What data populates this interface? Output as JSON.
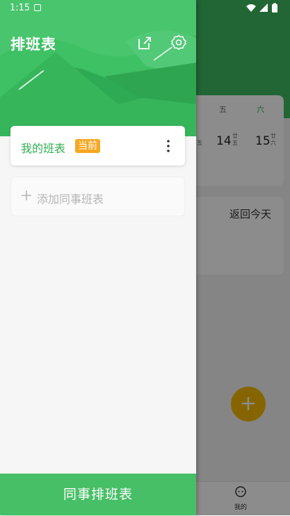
{
  "status_bar": {
    "time": "1:15"
  },
  "background": {
    "weekdays": [
      "五",
      "六"
    ],
    "dates": [
      {
        "num": "14",
        "lunar": "廿五"
      },
      {
        "num": "15",
        "lunar": "廿六"
      }
    ],
    "partial_lunar": "五",
    "back_today": "返回今天",
    "fab_symbol": "+",
    "tab_label": "我的"
  },
  "drawer": {
    "title": "排班表",
    "current_schedule": {
      "name": "我的班表",
      "badge": "当前"
    },
    "add_colleague": "添加同事班表",
    "footer_button": "同事排班表"
  },
  "colors": {
    "primary_green": "#47bf67",
    "badge_orange": "#f7a721",
    "fab_yellow": "#f5b800"
  },
  "icons": [
    "open-external-icon",
    "settings-gear-icon",
    "more-vertical-icon",
    "plus-icon",
    "wifi-icon",
    "signal-icon",
    "battery-icon"
  ]
}
